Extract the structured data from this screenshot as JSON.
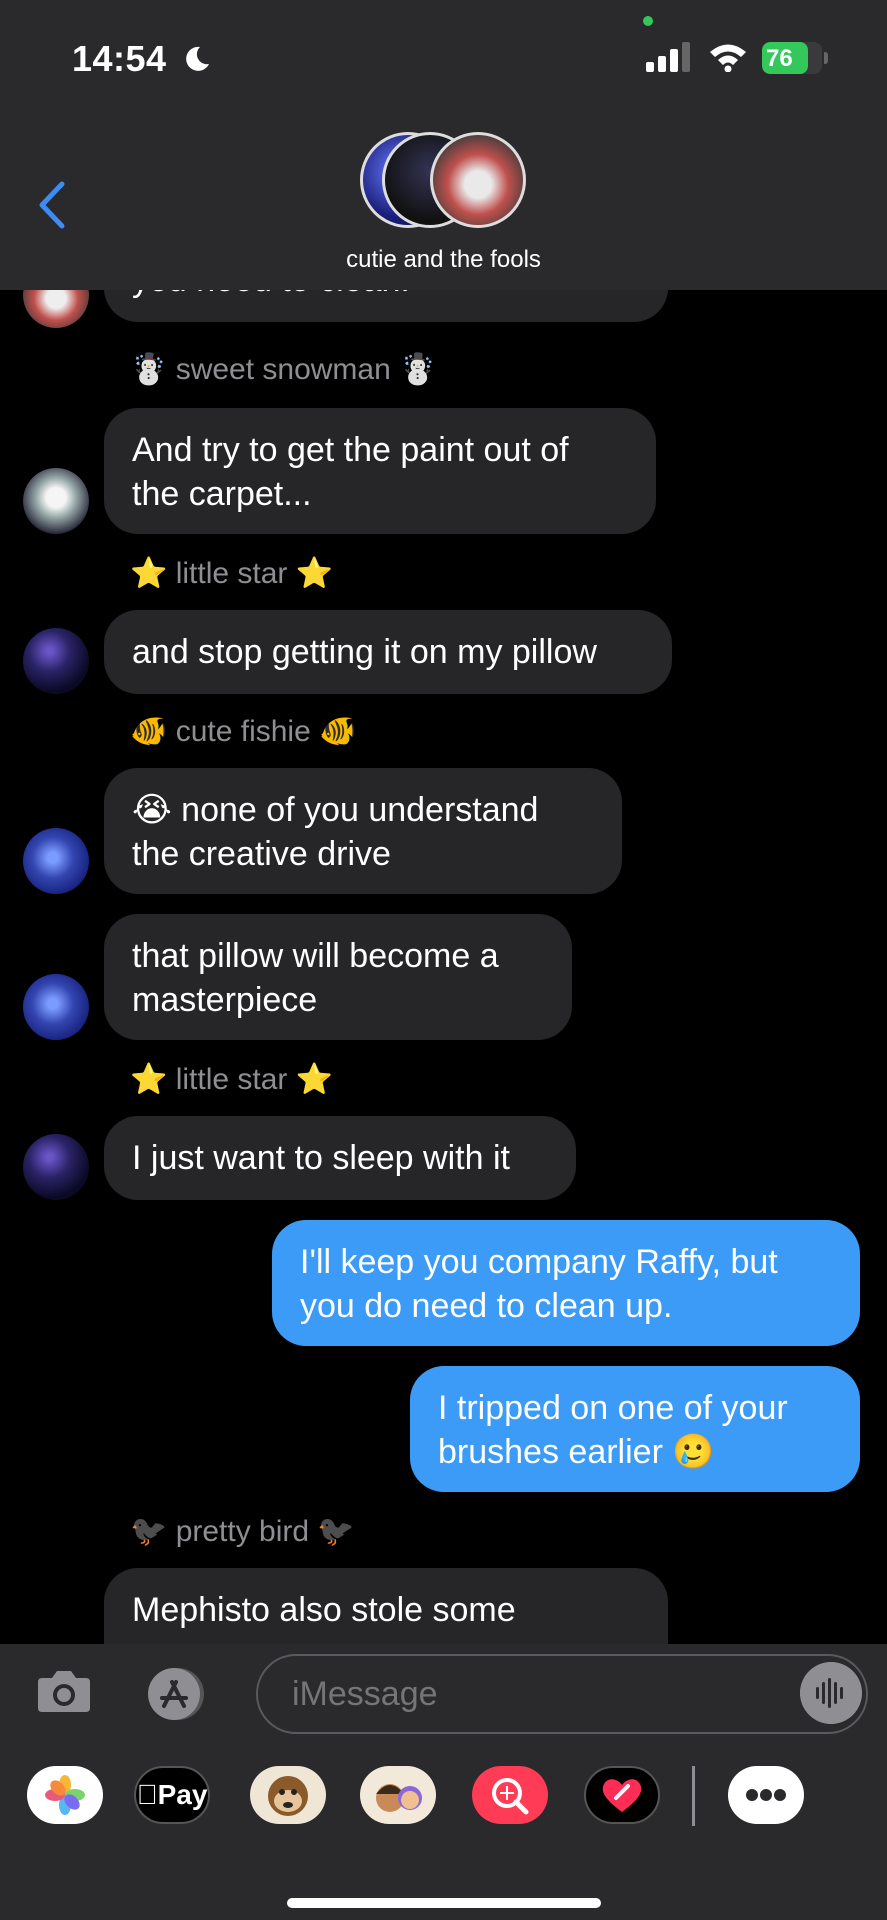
{
  "status": {
    "time": "14:54",
    "battery": "76"
  },
  "header": {
    "group_name": "cutie and the fools"
  },
  "messages": {
    "m0": "you need to clean.",
    "s1": "☃️ sweet snowman ☃️",
    "m1": "And try to get the paint out of\nthe carpet...",
    "s2": "⭐ little star ⭐",
    "m2": "and stop getting it on my pillow",
    "s3": "🐠 cute fishie 🐠",
    "m3": "😭 none of you understand\nthe creative drive",
    "m4": "that pillow will become a\nmasterpiece",
    "s4": "⭐ little star ⭐",
    "m5": "I just want to sleep with it",
    "m6": "I'll keep you company Raffy, but\nyou do need to clean up.",
    "m7": "I tripped on one of your\nbrushes earlier 🥲",
    "s5": "🐦‍⬛ pretty bird 🐦‍⬛",
    "m8": "Mephisto also stole some"
  },
  "composer": {
    "placeholder": "iMessage"
  },
  "app_strip": {
    "pay_label": "Pay"
  },
  "colors": {
    "sent_bubble": "#3b9bf7",
    "received_bubble": "#262628",
    "bar": "#2a2a2c"
  }
}
